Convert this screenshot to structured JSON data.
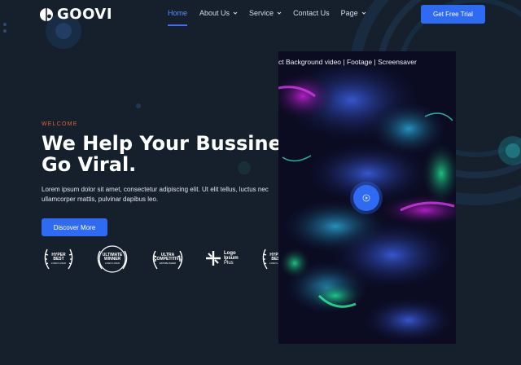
{
  "brand": {
    "name": "GOOVI"
  },
  "nav": {
    "items": [
      {
        "label": "Home",
        "active": true,
        "has_dropdown": false
      },
      {
        "label": "About Us",
        "active": false,
        "has_dropdown": true
      },
      {
        "label": "Service",
        "active": false,
        "has_dropdown": true
      },
      {
        "label": "Contact Us",
        "active": false,
        "has_dropdown": false
      },
      {
        "label": "Page",
        "active": false,
        "has_dropdown": true
      }
    ],
    "cta_label": "Get Free Trial"
  },
  "hero": {
    "eyebrow": "WELCOME",
    "title_line1": "We Help Your Bussiness",
    "title_line2": "Go Viral.",
    "description_line1": "Lorem ipsum dolor sit amet, consectetur adipiscing elit. Ut elit tellus, luctus nec",
    "description_line2": "ullamcorper mattis, pulvinar dapibus leo.",
    "button_label": "Discover More"
  },
  "badges": [
    {
      "line1": "HYPER",
      "line2": "BEST",
      "line3": "LOGO LOGO"
    },
    {
      "line1": "ULTIMATE",
      "line2": "WINNER",
      "line3": "LOGO LOGO"
    },
    {
      "line1": "ULTRA",
      "line2": "COMPETITIVE",
      "line3": "ESTABLISHED"
    },
    {
      "line1": "HYPER",
      "line2": "BEST",
      "line3": "LOGO LOGO"
    }
  ],
  "logo_badge": {
    "line1": "Logo",
    "line2": "Ipsum",
    "line3": "Plus"
  },
  "video": {
    "title": "ct Background video | Footage | Screensaver",
    "play_icon": "play-icon"
  },
  "colors": {
    "background": "#16202d",
    "accent": "#2f6bf2",
    "eyebrow": "#e2623f",
    "nav_active": "#5b8dff"
  }
}
